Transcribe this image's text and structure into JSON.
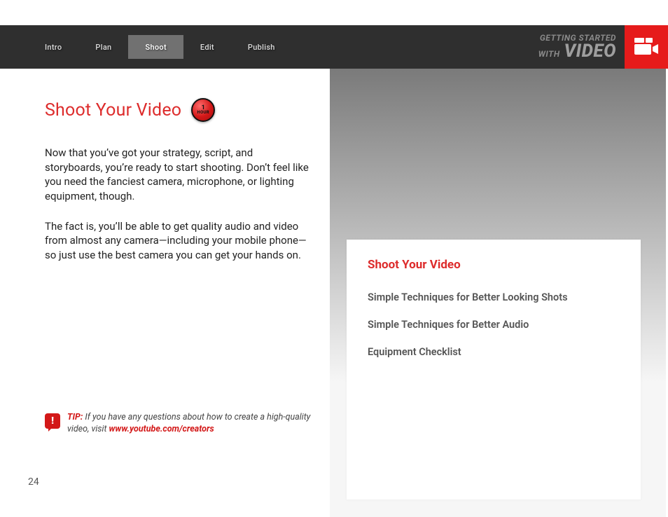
{
  "header": {
    "tabs": [
      {
        "label": "Intro",
        "active": false
      },
      {
        "label": "Plan",
        "active": false
      },
      {
        "label": "Shoot",
        "active": true
      },
      {
        "label": "Edit",
        "active": false
      },
      {
        "label": "Publish",
        "active": false
      }
    ],
    "brand_top": "GETTING STARTED",
    "brand_with": "WITH",
    "brand_video": "VIDEO"
  },
  "main": {
    "title": "Shoot Your Video",
    "badge": {
      "number": "1",
      "unit": "HOUR"
    },
    "para1": "Now that you’ve got your strategy, script, and storyboards, you’re ready to start shooting. Don’t feel like you need the fanciest camera, microphone, or lighting equipment, though.",
    "para2": "The fact is, you’ll be able to get quality audio and video from almost any camera—including your mobile phone—so just use the best camera you can get your hands on."
  },
  "tip": {
    "label": "TIP:",
    "text": " If you have any questions about how to create a high-quality video, visit ",
    "link": "www.youtube.com/creators"
  },
  "toc": {
    "heading": "Shoot Your Video",
    "items": [
      "Simple Techniques for Better Looking Shots",
      "Simple Techniques for Better Audio",
      "Equipment Checklist"
    ]
  },
  "page_number": "24"
}
